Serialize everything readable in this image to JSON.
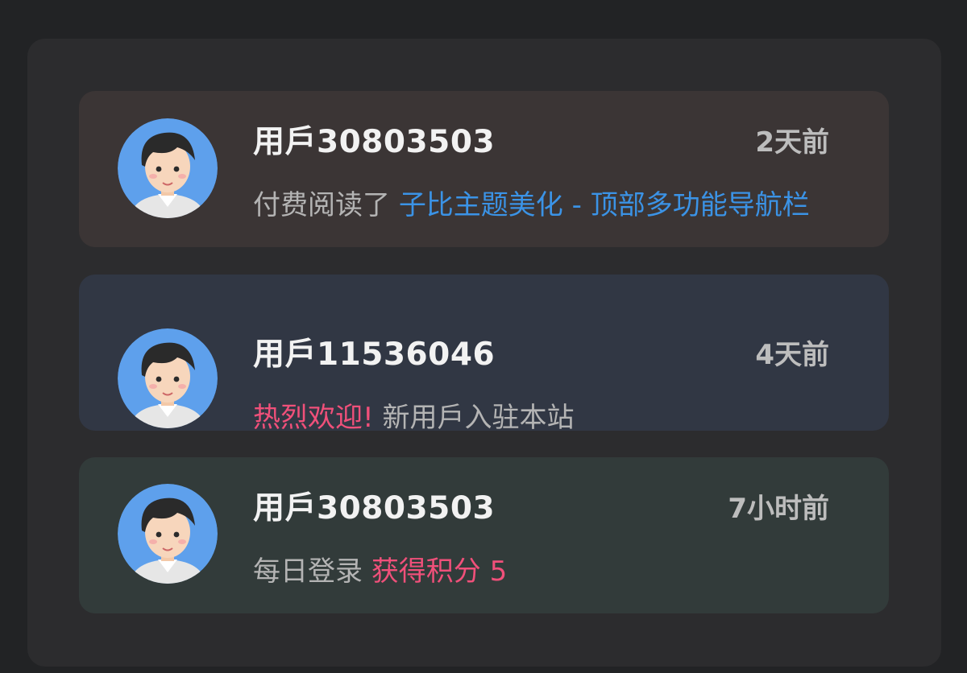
{
  "feed": {
    "items": [
      {
        "username": "用戶30803503",
        "time": "2天前",
        "action": "付费阅读了",
        "link_text": "子比主题美化 - 顶部多功能导航栏"
      },
      {
        "username": "用戶11536046",
        "time": "4天前",
        "highlight": "热烈欢迎!",
        "message": "新用戶入驻本站"
      },
      {
        "username": "用戶30803503",
        "time": "7小时前",
        "action": "每日登录",
        "highlight": "获得积分 5"
      }
    ]
  },
  "colors": {
    "link": "#3b93e6",
    "highlight": "#f0507a",
    "card_1_bg": "#3b3535",
    "card_2_bg": "#313744",
    "card_3_bg": "#323b3a"
  },
  "icons": {
    "avatar": "default-male-avatar-icon"
  }
}
